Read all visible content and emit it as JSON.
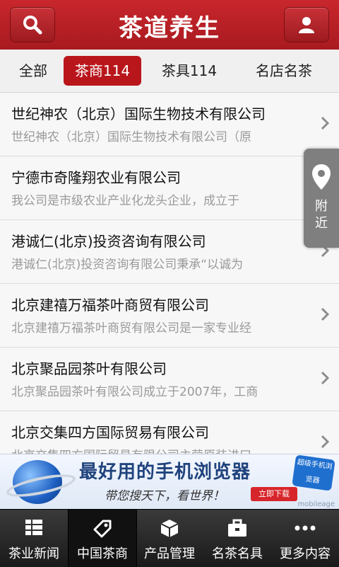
{
  "header": {
    "title": "茶道养生",
    "search_icon": "search-icon",
    "user_icon": "user-icon"
  },
  "tabs": [
    {
      "label": "全部"
    },
    {
      "label": "茶商114",
      "active": true
    },
    {
      "label": "茶具114"
    },
    {
      "label": "名店名茶"
    }
  ],
  "companies": [
    {
      "name": "世纪神农（北京）国际生物技术有限公司",
      "desc": "世纪神农（北京）国际生物技术有限公司（原"
    },
    {
      "name": "宁德市奇隆翔农业有限公司",
      "desc": "我公司是市级农业产业化龙头企业，成立于"
    },
    {
      "name": "港诚仁(北京)投资咨询有限公司",
      "desc": "港诚仁(北京)投资咨询有限公司秉承“以诚为"
    },
    {
      "name": "北京建禧万福茶叶商贸有限公司",
      "desc": "北京建禧万福茶叶商贸有限公司是一家专业经"
    },
    {
      "name": "北京聚品园茶叶有限公司",
      "desc": "北京聚品园茶叶有限公司成立于2007年，工商"
    },
    {
      "name": "北京交集四方国际贸易有限公司",
      "desc": "北京交集四方国际贸易有限公司主营原装进口"
    }
  ],
  "nearby": {
    "label_1": "附",
    "label_2": "近"
  },
  "ad": {
    "headline": "最好用的手机浏览器",
    "slogan": "带您搜天下，看世界！",
    "button": "立即下载",
    "badge": "超级手机浏览器",
    "brand": "mobileage"
  },
  "bottom_nav": [
    {
      "label": "茶业新闻",
      "icon": "list-icon"
    },
    {
      "label": "中国茶商",
      "icon": "tag-icon",
      "active": true
    },
    {
      "label": "产品管理",
      "icon": "box-icon"
    },
    {
      "label": "名茶名具",
      "icon": "briefcase-icon"
    },
    {
      "label": "更多内容",
      "icon": "more-icon"
    }
  ],
  "colors": {
    "brand_red": "#b9161c",
    "nav_dark": "#1a1a1a",
    "nearby_gray": "#7f7f7f"
  }
}
